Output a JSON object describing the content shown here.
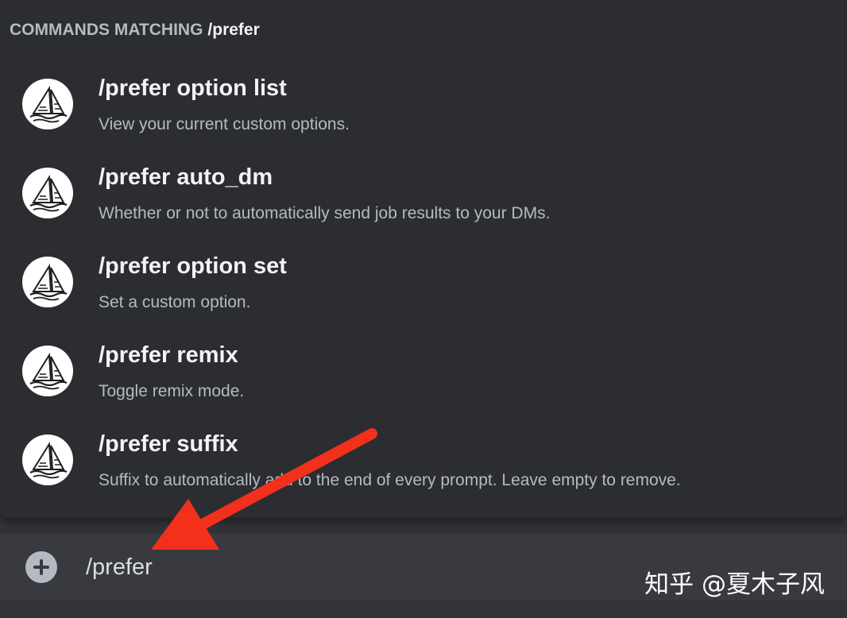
{
  "popup": {
    "header_prefix": "COMMANDS MATCHING",
    "header_query": "/prefer"
  },
  "commands": [
    {
      "name": "/prefer option list",
      "description": "View your current custom options.",
      "icon": "midjourney-sailboat-icon"
    },
    {
      "name": "/prefer auto_dm",
      "description": "Whether or not to automatically send job results to your DMs.",
      "icon": "midjourney-sailboat-icon"
    },
    {
      "name": "/prefer option set",
      "description": "Set a custom option.",
      "icon": "midjourney-sailboat-icon"
    },
    {
      "name": "/prefer remix",
      "description": "Toggle remix mode.",
      "icon": "midjourney-sailboat-icon"
    },
    {
      "name": "/prefer suffix",
      "description": "Suffix to automatically add to the end of every prompt. Leave empty to remove.",
      "icon": "midjourney-sailboat-icon"
    }
  ],
  "input": {
    "value": "/prefer",
    "add_icon": "plus-circle-icon"
  },
  "watermark": "知乎 @夏木子风",
  "colors": {
    "popup_bg": "#2b2d31",
    "page_bg": "#313338",
    "input_bg": "#383a40",
    "arrow": "#f2301b"
  }
}
